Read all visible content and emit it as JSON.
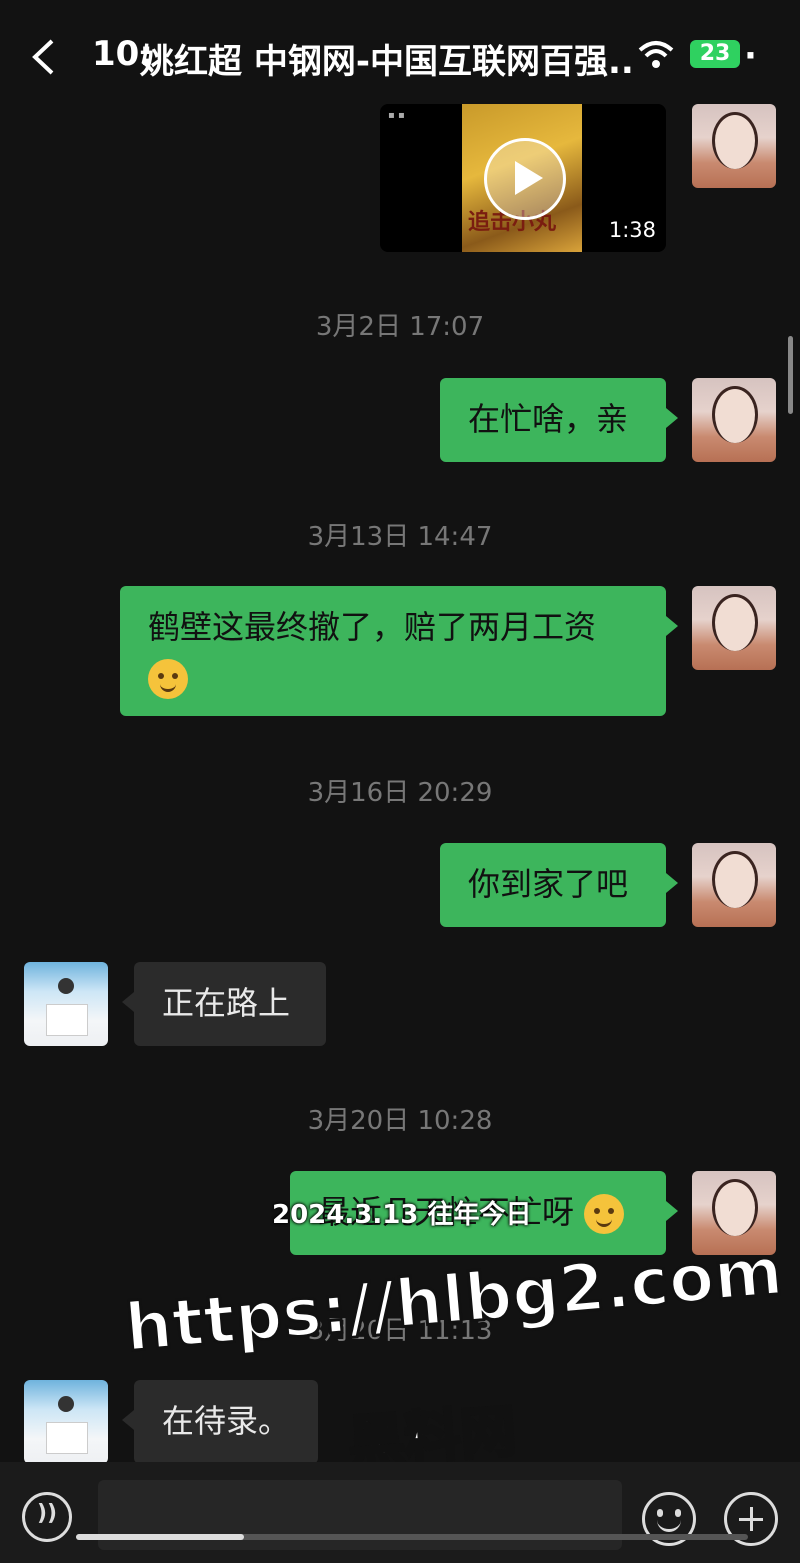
{
  "status": {
    "time": "10:",
    "more": "·"
  },
  "header": {
    "title": "姚红超 中钢网-中国互联网百强..",
    "battery": "23"
  },
  "video": {
    "duration": "1:38",
    "poster_text": "追击小丸"
  },
  "messages": [
    {
      "timestamp": "3月2日 17:07",
      "side": "me",
      "text": "在忙啥，亲"
    },
    {
      "timestamp": "3月13日 14:47",
      "side": "me",
      "text": "鹤壁这最终撤了，赔了两月工资"
    },
    {
      "timestamp": "3月16日 20:29",
      "side": "me",
      "text": "你到家了吧"
    },
    {
      "side": "them",
      "text": "正在路上"
    },
    {
      "timestamp": "3月20日 10:28",
      "side": "me",
      "text": "最近几天忙不忙呀"
    },
    {
      "timestamp": "3月20日 11:13",
      "side": "them",
      "text": "在待录。"
    }
  ],
  "overlay": {
    "date": "2024.3.13 往年今日"
  },
  "watermark": {
    "url": "https://hlbg2.com",
    "name": "黑料网"
  },
  "video_progress": 0.25
}
